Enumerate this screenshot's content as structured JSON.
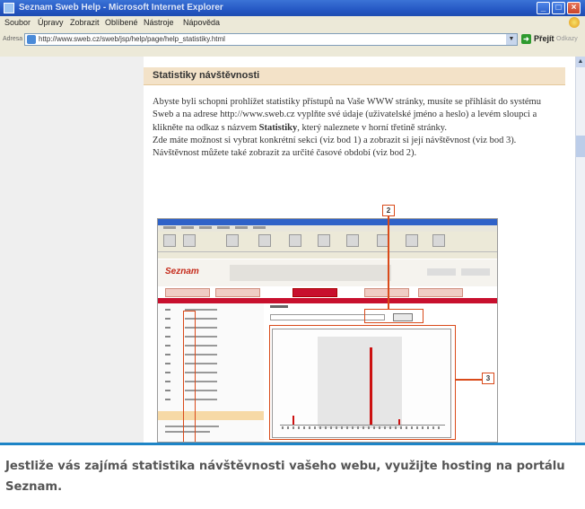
{
  "window": {
    "title": "Seznam Sweb Help - Microsoft Internet Explorer",
    "controls": [
      "minimize",
      "maximize",
      "close"
    ]
  },
  "menubar": {
    "items": [
      "Soubor",
      "Úpravy",
      "Zobrazit",
      "Oblíbené",
      "Nástroje",
      "Nápověda"
    ]
  },
  "addressbar": {
    "label": "Adresa",
    "url": "http://www.sweb.cz/sweb/jsp/help/page/help_statistiky.html",
    "go_label": "Přejít",
    "links_label": "Odkazy"
  },
  "page": {
    "heading": "Statistiky návštěvnosti",
    "paragraph_1_before_bold": "Abyste byli schopni prohlížet statistiky přístupů na Vaše WWW stránky, musíte se přihlásit do systému Sweb a na adrese http://www.sweb.cz vyplňte své údaje (uživatelské jméno a heslo) a levém sloupci a klikněte na odkaz s názvem ",
    "paragraph_1_bold": "Statistiky",
    "paragraph_1_after_bold": ", který naleznete v horní třetině stránky.",
    "paragraph_2": "Zde máte možnost si vybrat konkrétní sekci (viz bod 1) a zobrazit si její návštěvnost (viz bod 3). Návštěvnost můžete také zobrazit za určité časové období (viz bod 2)."
  },
  "inner_screenshot": {
    "logo": "Seznam",
    "callouts": [
      "2",
      "3"
    ]
  },
  "caption": {
    "text": "Jestliže vás zajímá statistika návštěvnosti vašeho webu, využijte hosting na portálu Seznam."
  },
  "colors": {
    "titlebar": "#2558c4",
    "accent_red": "#c8102e",
    "caption_rule": "#1d84c6",
    "annotation": "#d94a1a"
  }
}
